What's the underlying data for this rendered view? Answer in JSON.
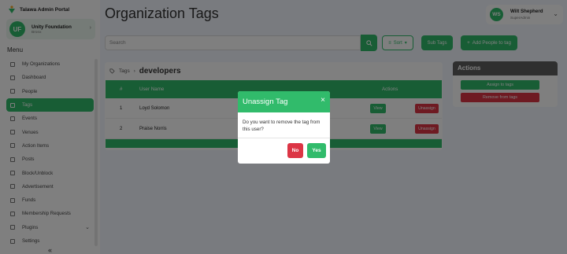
{
  "brand": {
    "name": "Talawa Admin Portal"
  },
  "org": {
    "initials": "UF",
    "name": "Unity Foundation",
    "city": "Bronx"
  },
  "menu": {
    "title": "Menu",
    "items": [
      {
        "label": "My Organizations",
        "icon": "organizations-icon"
      },
      {
        "label": "Dashboard",
        "icon": "dashboard-icon"
      },
      {
        "label": "People",
        "icon": "people-icon"
      },
      {
        "label": "Tags",
        "icon": "tag-icon",
        "active": true
      },
      {
        "label": "Events",
        "icon": "events-icon"
      },
      {
        "label": "Venues",
        "icon": "venues-icon"
      },
      {
        "label": "Action Items",
        "icon": "action-items-icon"
      },
      {
        "label": "Posts",
        "icon": "posts-icon"
      },
      {
        "label": "Block/Unblock",
        "icon": "block-icon"
      },
      {
        "label": "Advertisement",
        "icon": "advertisement-icon"
      },
      {
        "label": "Funds",
        "icon": "funds-icon"
      },
      {
        "label": "Membership Requests",
        "icon": "membership-icon"
      },
      {
        "label": "Plugins",
        "icon": "plugins-icon"
      },
      {
        "label": "Settings",
        "icon": "settings-icon"
      }
    ],
    "collapse": "«"
  },
  "header": {
    "title": "Organization Tags"
  },
  "profile": {
    "initials": "WS",
    "name": "Wilt Shepherd",
    "role": "SuperAdmin"
  },
  "toolbar": {
    "search_placeholder": "Search",
    "sort_label": "Sort",
    "subtags_label": "Sub Tags",
    "add_people_label": "Add People to tag"
  },
  "breadcrumb": {
    "root": "Tags",
    "current": "developers"
  },
  "table": {
    "columns": [
      "#",
      "User Name",
      "Actions"
    ],
    "rows": [
      {
        "num": "1",
        "name": "Loyd Solomon"
      },
      {
        "num": "2",
        "name": "Praise Norris"
      }
    ],
    "view_label": "View",
    "unassign_label": "Unassign"
  },
  "actions_panel": {
    "title": "Actions",
    "assign_label": "Assign to tags",
    "remove_label": "Remove from tags"
  },
  "modal": {
    "title": "Unassign Tag",
    "close": "×",
    "body": "Do you want to remove the tag from this user?",
    "no_label": "No",
    "yes_label": "Yes"
  },
  "colors": {
    "accent": "#31bb6b",
    "danger": "#dc3545",
    "dark": "#5e5e5e"
  }
}
